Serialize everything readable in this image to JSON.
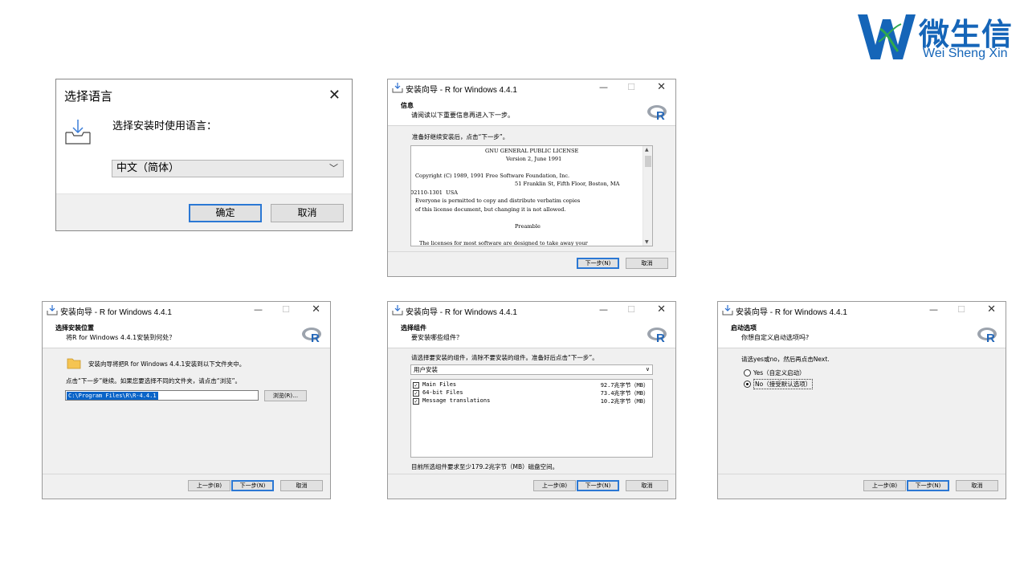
{
  "logo": {
    "chinese": "微生信",
    "english": "Wei Sheng Xin"
  },
  "language_dialog": {
    "title": "选择语言",
    "prompt": "选择安装时使用语言：",
    "selected_language": "中文（简体）",
    "ok_label": "确定",
    "cancel_label": "取消"
  },
  "window_title": "安装向导 - R for Windows 4.4.1",
  "buttons": {
    "back": "上一步(B)",
    "next": "下一步(N)",
    "cancel": "取消"
  },
  "info_page": {
    "heading": "信息",
    "subheading": "请阅读以下重要信息再进入下一步。",
    "intro": "准备好继续安装后，点击“下一步”。",
    "license_lines": [
      "GNU GENERAL PUBLIC LICENSE",
      "Version 2, June 1991",
      "Copyright (C) 1989, 1991 Free Software Foundation, Inc.",
      "51 Franklin St, Fifth Floor, Boston, MA",
      "02110-1301  USA",
      "Everyone is permitted to copy and distribute verbatim copies",
      "of this license document, but changing it is not allowed.",
      "Preamble",
      "The licenses for most software are designed to take away your"
    ]
  },
  "location_page": {
    "heading": "选择安装位置",
    "subheading": "将R for Windows 4.4.1安装到何处？",
    "line1": "安装向导将把R for Windows 4.4.1安装到以下文件夹中。",
    "line2": "点击“下一步”继续。如果您要选择不同的文件夹，请点击“浏览”。",
    "path": "C:\\Program Files\\R\\R-4.4.1",
    "browse_label": "浏览(R)…"
  },
  "components_page": {
    "heading": "选择组件",
    "subheading": "要安装哪些组件？",
    "intro": "请选择要安装的组件，清除不要安装的组件。准备好后点击“下一步”。",
    "install_type": "用户安装",
    "components": [
      {
        "name": "Main Files",
        "size": "92.7兆字节（MB）",
        "checked": true
      },
      {
        "name": "64-bit Files",
        "size": "73.4兆字节（MB）",
        "checked": true
      },
      {
        "name": "Message translations",
        "size": "10.2兆字节（MB）",
        "checked": true
      }
    ],
    "requirement": "目前所选组件要求至少179.2兆字节（MB）磁盘空间。"
  },
  "startup_page": {
    "heading": "启动选项",
    "subheading": "你想自定义启动选项吗?",
    "intro": "请选yes或no，然后再点击Next.",
    "option_yes": "Yes（自定义启动）",
    "option_no": "No（接受默认选项）",
    "selected": "no"
  },
  "colors": {
    "accent": "#1565b8",
    "selection": "#0a64c8",
    "dialog_bg": "#f0f0f0"
  }
}
